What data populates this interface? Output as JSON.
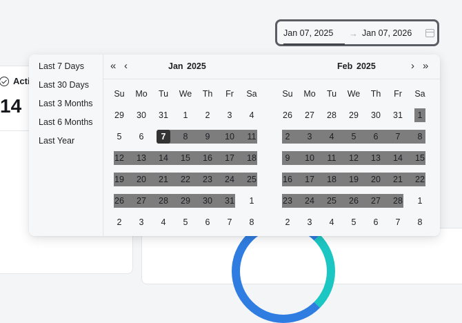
{
  "background": {
    "card_label": "Acti",
    "card_value": "14"
  },
  "range_input": {
    "start_date": "Jan 07, 2025",
    "end_date": "Jan 07, 2026",
    "separator": "→",
    "icon": "calendar-icon"
  },
  "presets": [
    "Last 7 Days",
    "Last 30 Days",
    "Last 3 Months",
    "Last 6 Months",
    "Last Year"
  ],
  "weekdays": [
    "Su",
    "Mo",
    "Tu",
    "We",
    "Th",
    "Fr",
    "Sa"
  ],
  "calendars": [
    {
      "month_label": "Jan",
      "year_label": "2025",
      "nav_prev_year": "«",
      "nav_prev_month": "‹",
      "weeks": [
        [
          "29",
          "30",
          "31",
          "1",
          "2",
          "3",
          "4"
        ],
        [
          "5",
          "6",
          "7",
          "8",
          "9",
          "10",
          "11"
        ],
        [
          "12",
          "13",
          "14",
          "15",
          "16",
          "17",
          "18"
        ],
        [
          "19",
          "20",
          "21",
          "22",
          "23",
          "24",
          "25"
        ],
        [
          "26",
          "27",
          "28",
          "29",
          "30",
          "31",
          "1"
        ],
        [
          "2",
          "3",
          "4",
          "5",
          "6",
          "7",
          "8"
        ]
      ],
      "range_start": "Jan 7",
      "highlight_bands": [
        {
          "row": 1,
          "from_col": 2,
          "to_col": 6
        },
        {
          "row": 2,
          "from_col": 0,
          "to_col": 6
        },
        {
          "row": 3,
          "from_col": 0,
          "to_col": 6
        },
        {
          "row": 4,
          "from_col": 0,
          "to_col": 5
        }
      ],
      "selected_cell": {
        "row": 1,
        "col": 2
      }
    },
    {
      "month_label": "Feb",
      "year_label": "2025",
      "nav_next_month": "›",
      "nav_next_year": "»",
      "weeks": [
        [
          "26",
          "27",
          "28",
          "29",
          "30",
          "31",
          "1"
        ],
        [
          "2",
          "3",
          "4",
          "5",
          "6",
          "7",
          "8"
        ],
        [
          "9",
          "10",
          "11",
          "12",
          "13",
          "14",
          "15"
        ],
        [
          "16",
          "17",
          "18",
          "19",
          "20",
          "21",
          "22"
        ],
        [
          "23",
          "24",
          "25",
          "26",
          "27",
          "28",
          "1"
        ],
        [
          "2",
          "3",
          "4",
          "5",
          "6",
          "7",
          "8"
        ]
      ],
      "highlight_bands": [
        {
          "row": 0,
          "from_col": 6,
          "to_col": 6
        },
        {
          "row": 1,
          "from_col": 0,
          "to_col": 6
        },
        {
          "row": 2,
          "from_col": 0,
          "to_col": 6
        },
        {
          "row": 3,
          "from_col": 0,
          "to_col": 6
        },
        {
          "row": 4,
          "from_col": 0,
          "to_col": 5
        }
      ]
    }
  ],
  "colors": {
    "range_highlight": "#7d7d7d",
    "selected_day": "#333333",
    "donut_blue": "#2f7de1",
    "donut_teal": "#1cc6c2"
  }
}
